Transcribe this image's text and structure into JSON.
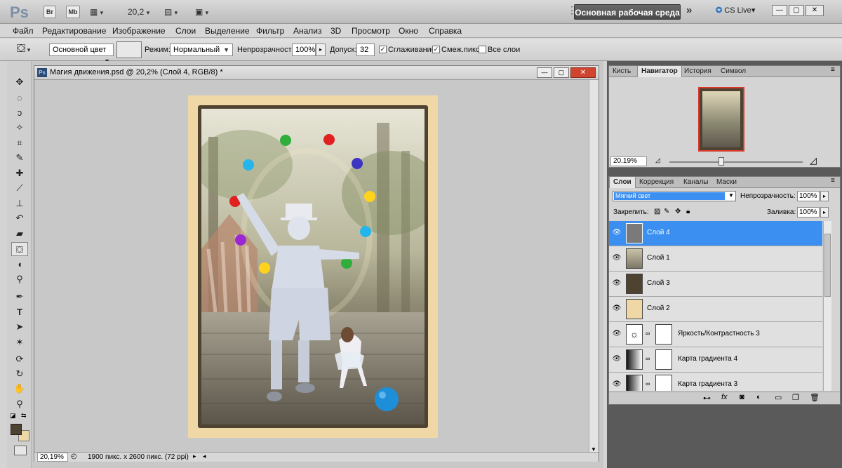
{
  "app": {
    "logo": "Ps",
    "badge_br": "Br",
    "badge_mb": "Mb",
    "zoom_display": "20,2",
    "workspace": "Основная рабочая среда",
    "cs_live": "CS Live"
  },
  "menu": [
    "Файл",
    "Редактирование",
    "Изображение",
    "Слои",
    "Выделение",
    "Фильтр",
    "Анализ",
    "3D",
    "Просмотр",
    "Окно",
    "Справка"
  ],
  "options": {
    "fill_source": "Основной цвет",
    "mode_label": "Режим:",
    "mode_value": "Нормальный",
    "opacity_label": "Непрозрачность:",
    "opacity_value": "100%",
    "tolerance_label": "Допуск:",
    "tolerance_value": "32",
    "antialias_label": "Сглаживание",
    "contiguous_label": "Смеж.пикс",
    "all_layers_label": "Все слои"
  },
  "document": {
    "title": "Магия движения.psd @ 20,2% (Слой 4, RGB/8) *",
    "zoom": "20,19%",
    "info": "1900 пикс. x 2600 пикс. (72 ppi)"
  },
  "navigator": {
    "tabs": [
      "Кисть",
      "Навигатор",
      "История",
      "Символ"
    ],
    "active": 1,
    "zoom": "20.19%"
  },
  "layers_panel": {
    "tabs": [
      "Слои",
      "Коррекция",
      "Каналы",
      "Маски"
    ],
    "blend_mode": "Мягкий свет",
    "opacity_label": "Непрозрачность:",
    "opacity_value": "100%",
    "lock_label": "Закрепить:",
    "fill_label": "Заливка:",
    "fill_value": "100%",
    "layers": [
      {
        "name": "Слой 4",
        "selected": true
      },
      {
        "name": "Слой 1",
        "selected": false
      },
      {
        "name": "Слой 3",
        "selected": false
      },
      {
        "name": "Слой 2",
        "selected": false
      },
      {
        "name": "Яркость/Контрастность 3",
        "selected": false
      },
      {
        "name": "Карта градиента 4",
        "selected": false
      },
      {
        "name": "Карта градиента 3",
        "selected": false
      }
    ]
  },
  "colors": {
    "accent": "#3a8ff0",
    "frame_beige": "#f0d8a6",
    "frame_brown": "#4e4231",
    "fg_color": "#4e4231",
    "bg_color": "#ecd9a6"
  }
}
